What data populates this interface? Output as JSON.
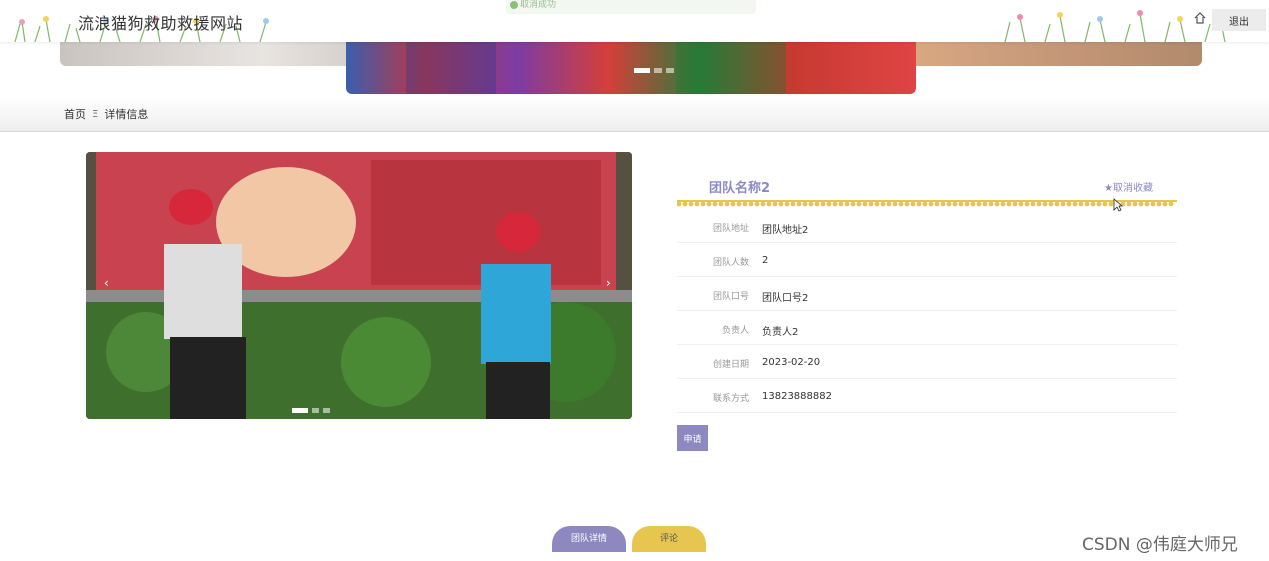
{
  "header": {
    "site_title": "流浪猫狗救助救援网站",
    "toast_text": "取消成功",
    "logout_label": "退出"
  },
  "breadcrumb": {
    "home": "首页",
    "separator": "Ξ",
    "current": "详情信息"
  },
  "detail": {
    "name": "团队名称2",
    "favorite_label": "★取消收藏",
    "fields": [
      {
        "label": "团队地址",
        "value": "团队地址2"
      },
      {
        "label": "团队人数",
        "value": "2"
      },
      {
        "label": "团队口号",
        "value": "团队口号2"
      },
      {
        "label": "负责人",
        "value": "负责人2"
      },
      {
        "label": "创建日期",
        "value": "2023-02-20"
      },
      {
        "label": "联系方式",
        "value": "13823888882"
      }
    ],
    "apply_label": "申请"
  },
  "tabs": [
    {
      "label": "团队详情"
    },
    {
      "label": "评论"
    }
  ],
  "watermark": "CSDN @伟庭大师兄",
  "colors": {
    "accent": "#8d88c0",
    "tab_secondary": "#e6c64e"
  }
}
